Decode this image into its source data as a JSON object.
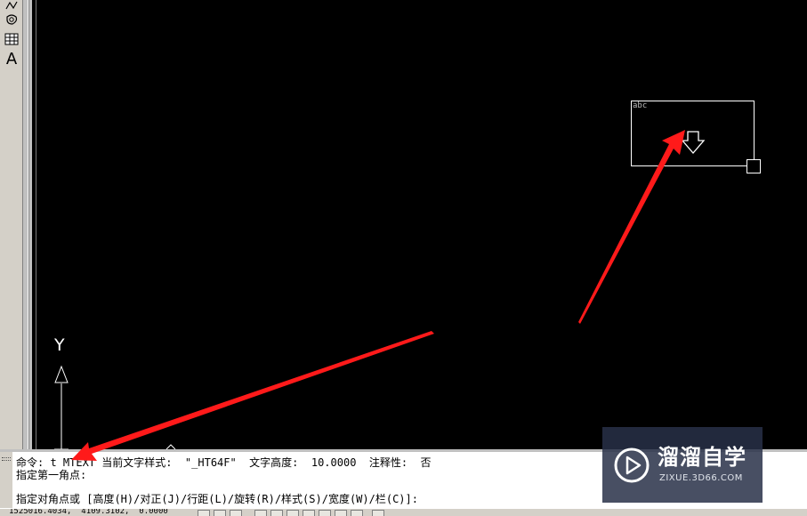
{
  "toolbar": {
    "icons": [
      "polyline-icon",
      "region-icon",
      "table-icon",
      "multiline-text-icon"
    ],
    "text_tool_label": "A"
  },
  "canvas": {
    "background": "#000000",
    "ucs_y_label": "Y",
    "mtext_sample": "abc"
  },
  "command": {
    "line1": "命令: t MTEXT 当前文字样式:  \"_HT64F\"  文字高度:  10.0000  注释性:  否",
    "line2": "指定第一角点:",
    "line3": "指定对角点或 [高度(H)/对正(J)/行距(L)/旋转(R)/样式(S)/宽度(W)/栏(C)]:"
  },
  "status": {
    "coords": "1525016.4034,  4109.3102,  0.0000"
  },
  "annotation": {
    "arrow_color": "#ff1a1a"
  },
  "watermark": {
    "title": "溜溜自学",
    "url": "ZIXUE.3D66.COM"
  }
}
